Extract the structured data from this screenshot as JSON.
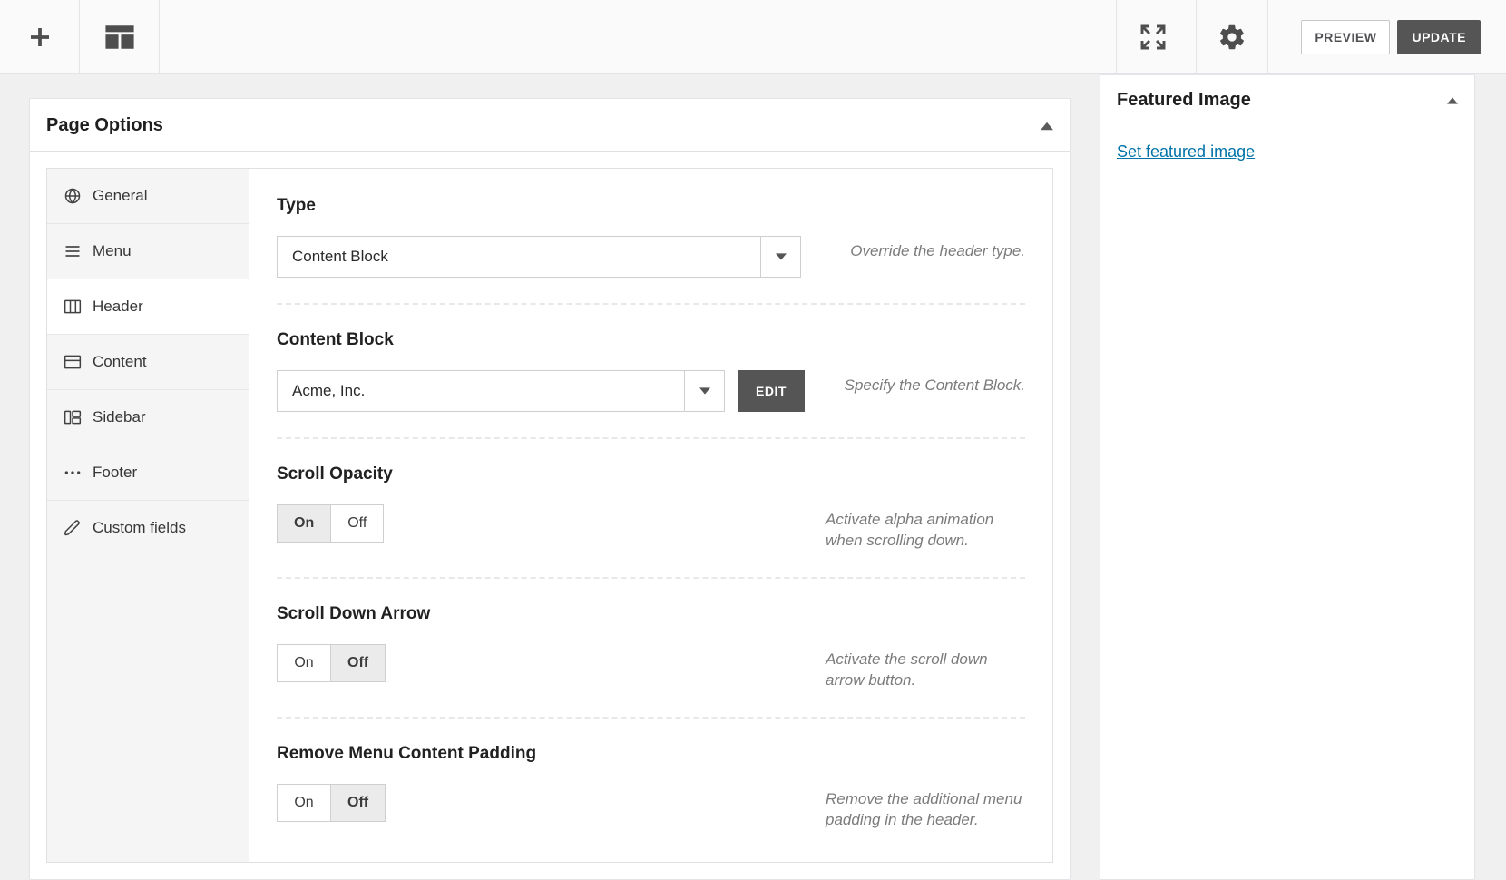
{
  "toolbar": {
    "preview_label": "PREVIEW",
    "update_label": "UPDATE"
  },
  "panel": {
    "title": "Page Options",
    "tabs": [
      {
        "label": "General"
      },
      {
        "label": "Menu"
      },
      {
        "label": "Header"
      },
      {
        "label": "Content"
      },
      {
        "label": "Sidebar"
      },
      {
        "label": "Footer"
      },
      {
        "label": "Custom fields"
      }
    ]
  },
  "fields": {
    "type": {
      "label": "Type",
      "value": "Content Block",
      "help": "Override the header type."
    },
    "content_block": {
      "label": "Content Block",
      "value": "Acme, Inc.",
      "edit_label": "EDIT",
      "help": "Specify the Content Block."
    },
    "scroll_opacity": {
      "label": "Scroll Opacity",
      "on_label": "On",
      "off_label": "Off",
      "active": "on",
      "help": "Activate alpha animation when scrolling down."
    },
    "scroll_down_arrow": {
      "label": "Scroll Down Arrow",
      "on_label": "On",
      "off_label": "Off",
      "active": "off",
      "help": "Activate the scroll down arrow button."
    },
    "remove_menu_padding": {
      "label": "Remove Menu Content Padding",
      "on_label": "On",
      "off_label": "Off",
      "active": "off",
      "help": "Remove the additional menu padding in the header."
    }
  },
  "side": {
    "title": "Featured Image",
    "link_label": "Set featured image"
  }
}
